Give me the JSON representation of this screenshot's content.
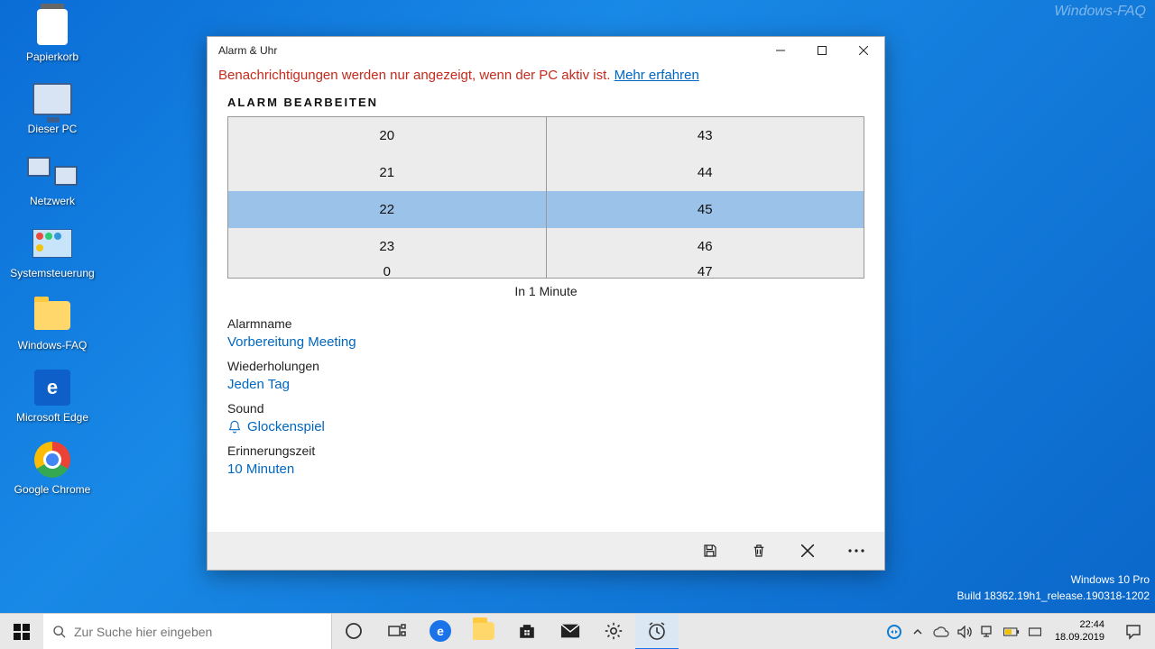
{
  "desktop": {
    "icons": [
      {
        "label": "Papierkorb"
      },
      {
        "label": "Dieser PC"
      },
      {
        "label": "Netzwerk"
      },
      {
        "label": "Systemsteuerung"
      },
      {
        "label": "Windows-FAQ"
      },
      {
        "label": "Microsoft Edge"
      },
      {
        "label": "Google Chrome"
      }
    ]
  },
  "window": {
    "title": "Alarm & Uhr",
    "notice_text": "Benachrichtigungen werden nur angezeigt, wenn der PC aktiv ist. ",
    "notice_link": "Mehr erfahren",
    "section": "ALARM BEARBEITEN",
    "hours": [
      "20",
      "21",
      "22",
      "23",
      "0"
    ],
    "minutes": [
      "43",
      "44",
      "45",
      "46",
      "47"
    ],
    "selected_hour": "22",
    "selected_minute": "45",
    "countdown": "In 1 Minute",
    "fields": {
      "name_label": "Alarmname",
      "name_value": "Vorbereitung Meeting",
      "repeat_label": "Wiederholungen",
      "repeat_value": "Jeden Tag",
      "sound_label": "Sound",
      "sound_value": "Glockenspiel",
      "snooze_label": "Erinnerungszeit",
      "snooze_value": "10 Minuten"
    }
  },
  "watermark": {
    "edition": "Windows 10 Pro",
    "build": "Build 18362.19h1_release.190318-1202"
  },
  "taskbar": {
    "search_placeholder": "Zur Suche hier eingeben",
    "clock_time": "22:44",
    "clock_date": "18.09.2019"
  },
  "top_right": "Windows-FAQ"
}
